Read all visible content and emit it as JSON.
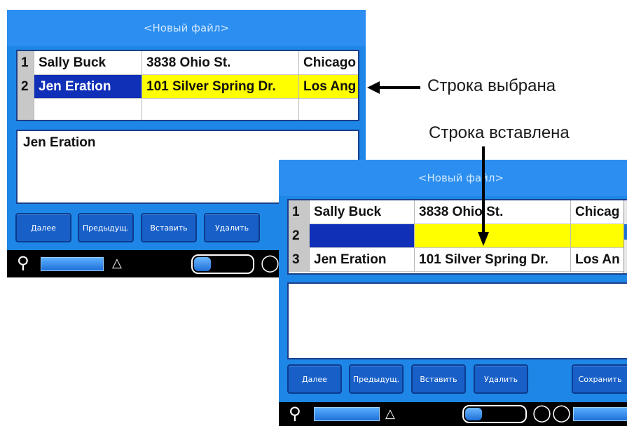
{
  "screen1": {
    "title": "<Новый файл>",
    "rows": [
      {
        "num": "1",
        "name": "Sally Buck",
        "address": "3838 Ohio St.",
        "city": "Chicago"
      },
      {
        "num": "2",
        "name": "Jen Eration",
        "address": "101 Silver Spring Dr.",
        "city": "Los Ang"
      }
    ],
    "text_value": "Jen Eration",
    "buttons": [
      "Далее",
      "Предыдущ.",
      "Вставить",
      "Удалить"
    ]
  },
  "screen2": {
    "title": "<Новый файл>",
    "rows": [
      {
        "num": "1",
        "name": "Sally Buck",
        "address": "3838 Ohio St.",
        "city": "Chicag"
      },
      {
        "num": "2",
        "name": "",
        "address": "",
        "city": ""
      },
      {
        "num": "3",
        "name": "Jen Eration",
        "address": "101 Silver Spring Dr.",
        "city": "Los An"
      }
    ],
    "text_value": "",
    "buttons": [
      "Далее",
      "Предыдущ.",
      "Вставить",
      "Удалить",
      "Сохранить"
    ]
  },
  "callouts": {
    "row_selected": "Строка выбрана",
    "row_inserted": "Строка вставлена"
  },
  "colors": {
    "screen_bg": "#1e86e6",
    "selected_blue": "#1030b8",
    "highlight_yellow": "#ffff00"
  },
  "icons": [
    "search-icon",
    "font-icon",
    "battery-icon",
    "tape-icon"
  ]
}
